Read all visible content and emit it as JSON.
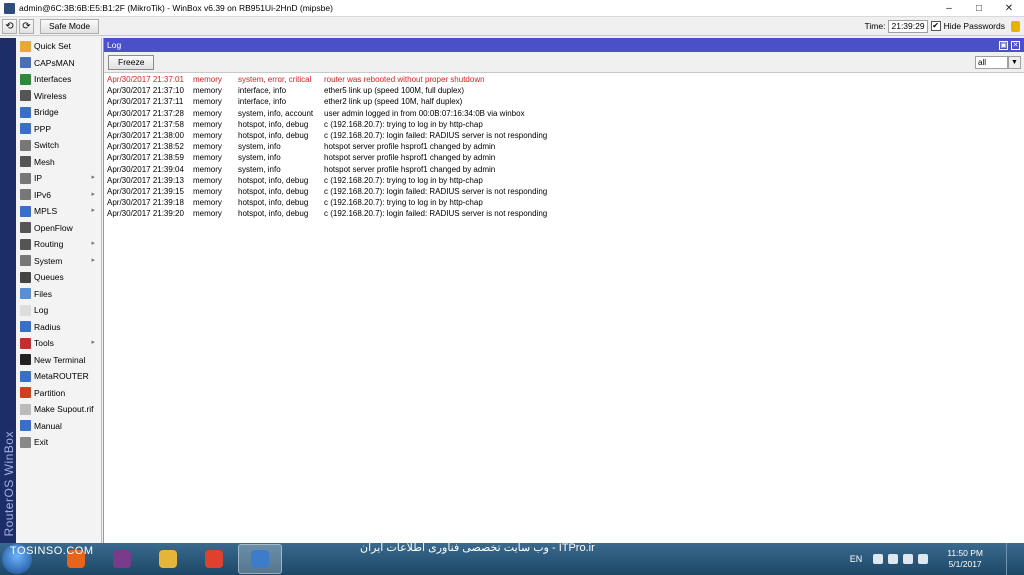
{
  "window": {
    "title": "admin@6C:3B:6B:E5:B1:2F (MikroTik) - WinBox v6.39 on RB951Ui-2HnD (mipsbe)",
    "minimize": "–",
    "maximize": "□",
    "close": "✕"
  },
  "toolbar": {
    "undo_label": "⟲",
    "redo_label": "⟳",
    "safe_mode_label": "Safe Mode",
    "time_label": "Time:",
    "time_value": "21:39:29",
    "hide_passwords_label": "Hide Passwords",
    "hide_passwords_checked": "✔"
  },
  "brand": "RouterOS WinBox",
  "menu": {
    "items": [
      {
        "label": "Quick Set",
        "icon": "quick-set-icon",
        "color": "#e9a83a"
      },
      {
        "label": "CAPsMAN",
        "icon": "capsman-icon",
        "color": "#4a6fb5"
      },
      {
        "label": "Interfaces",
        "icon": "interfaces-icon",
        "color": "#2d8a3a"
      },
      {
        "label": "Wireless",
        "icon": "wireless-icon",
        "color": "#555555"
      },
      {
        "label": "Bridge",
        "icon": "bridge-icon",
        "color": "#3a6fc9"
      },
      {
        "label": "PPP",
        "icon": "ppp-icon",
        "color": "#3a6fc9"
      },
      {
        "label": "Switch",
        "icon": "switch-icon",
        "color": "#777777"
      },
      {
        "label": "Mesh",
        "icon": "mesh-icon",
        "color": "#555555"
      },
      {
        "label": "IP",
        "icon": "ip-icon",
        "color": "#777777",
        "arrow": "▸"
      },
      {
        "label": "IPv6",
        "icon": "ipv6-icon",
        "color": "#777777",
        "arrow": "▸"
      },
      {
        "label": "MPLS",
        "icon": "mpls-icon",
        "color": "#3a6fc9",
        "arrow": "▸"
      },
      {
        "label": "OpenFlow",
        "icon": "openflow-icon",
        "color": "#555555"
      },
      {
        "label": "Routing",
        "icon": "routing-icon",
        "color": "#555555",
        "arrow": "▸"
      },
      {
        "label": "System",
        "icon": "system-icon",
        "color": "#777777",
        "arrow": "▸"
      },
      {
        "label": "Queues",
        "icon": "queues-icon",
        "color": "#444444"
      },
      {
        "label": "Files",
        "icon": "files-icon",
        "color": "#5a8fd6"
      },
      {
        "label": "Log",
        "icon": "log-icon",
        "color": "#dddddd"
      },
      {
        "label": "Radius",
        "icon": "radius-icon",
        "color": "#3a6fc9"
      },
      {
        "label": "Tools",
        "icon": "tools-icon",
        "color": "#c03030",
        "arrow": "▸"
      },
      {
        "label": "New Terminal",
        "icon": "terminal-icon",
        "color": "#222222"
      },
      {
        "label": "MetaROUTER",
        "icon": "metarouter-icon",
        "color": "#3a6fc9"
      },
      {
        "label": "Partition",
        "icon": "partition-icon",
        "color": "#d04020"
      },
      {
        "label": "Make Supout.rif",
        "icon": "supout-icon",
        "color": "#bbbbbb"
      },
      {
        "label": "Manual",
        "icon": "manual-icon",
        "color": "#3a6fc9"
      },
      {
        "label": "Exit",
        "icon": "exit-icon",
        "color": "#888888"
      }
    ]
  },
  "log": {
    "title": "Log",
    "freeze_label": "Freeze",
    "filter_value": "all",
    "filter_arrow": "▼",
    "entries": [
      {
        "time": "Apr/30/2017 21:37:01",
        "buffer": "memory",
        "topics": "system, error, critical",
        "message": "router was rebooted without proper shutdown",
        "error": true
      },
      {
        "time": "Apr/30/2017 21:37:10",
        "buffer": "memory",
        "topics": "interface, info",
        "message": "ether5 link up (speed 100M, full duplex)"
      },
      {
        "time": "Apr/30/2017 21:37:11",
        "buffer": "memory",
        "topics": "interface, info",
        "message": "ether2 link up (speed 10M, half duplex)"
      },
      {
        "time": "Apr/30/2017 21:37:28",
        "buffer": "memory",
        "topics": "system, info, account",
        "message": "user admin logged in from 00:0B:07:16:34:0B via winbox"
      },
      {
        "time": "Apr/30/2017 21:37:58",
        "buffer": "memory",
        "topics": "hotspot, info, debug",
        "message": "c (192.168.20.7): trying to log in by http-chap"
      },
      {
        "time": "Apr/30/2017 21:38:00",
        "buffer": "memory",
        "topics": "hotspot, info, debug",
        "message": "c (192.168.20.7): login failed: RADIUS server is not responding"
      },
      {
        "time": "Apr/30/2017 21:38:52",
        "buffer": "memory",
        "topics": "system, info",
        "message": "hotspot server profile hsprof1 changed by admin"
      },
      {
        "time": "Apr/30/2017 21:38:59",
        "buffer": "memory",
        "topics": "system, info",
        "message": "hotspot server profile hsprof1 changed by admin"
      },
      {
        "time": "Apr/30/2017 21:39:04",
        "buffer": "memory",
        "topics": "system, info",
        "message": "hotspot server profile hsprof1 changed by admin"
      },
      {
        "time": "Apr/30/2017 21:39:13",
        "buffer": "memory",
        "topics": "hotspot, info, debug",
        "message": "c (192.168.20.7): trying to log in by http-chap"
      },
      {
        "time": "Apr/30/2017 21:39:15",
        "buffer": "memory",
        "topics": "hotspot, info, debug",
        "message": "c (192.168.20.7): login failed: RADIUS server is not responding"
      },
      {
        "time": "Apr/30/2017 21:39:18",
        "buffer": "memory",
        "topics": "hotspot, info, debug",
        "message": "c (192.168.20.7): trying to log in by http-chap"
      },
      {
        "time": "Apr/30/2017 21:39:20",
        "buffer": "memory",
        "topics": "hotspot, info, debug",
        "message": "c (192.168.20.7): login failed: RADIUS server is not responding"
      }
    ]
  },
  "taskbar": {
    "watermark_left": "TOSINSO.COM",
    "watermark_center": "وب سایت تخصصی فناوری اطلاعات ایران - ITPro.ir",
    "apps": [
      {
        "icon": "firefox-icon",
        "color": "#e8641b"
      },
      {
        "icon": "winrar-icon",
        "color": "#7a3c8a"
      },
      {
        "icon": "file-explorer-icon",
        "color": "#e5b53a"
      },
      {
        "icon": "recorder-icon",
        "color": "#e0412f"
      },
      {
        "icon": "winbox-icon",
        "color": "#3d7cc9",
        "active": true
      }
    ],
    "language": "EN",
    "time": "11:50 PM",
    "date": "5/1/2017"
  }
}
